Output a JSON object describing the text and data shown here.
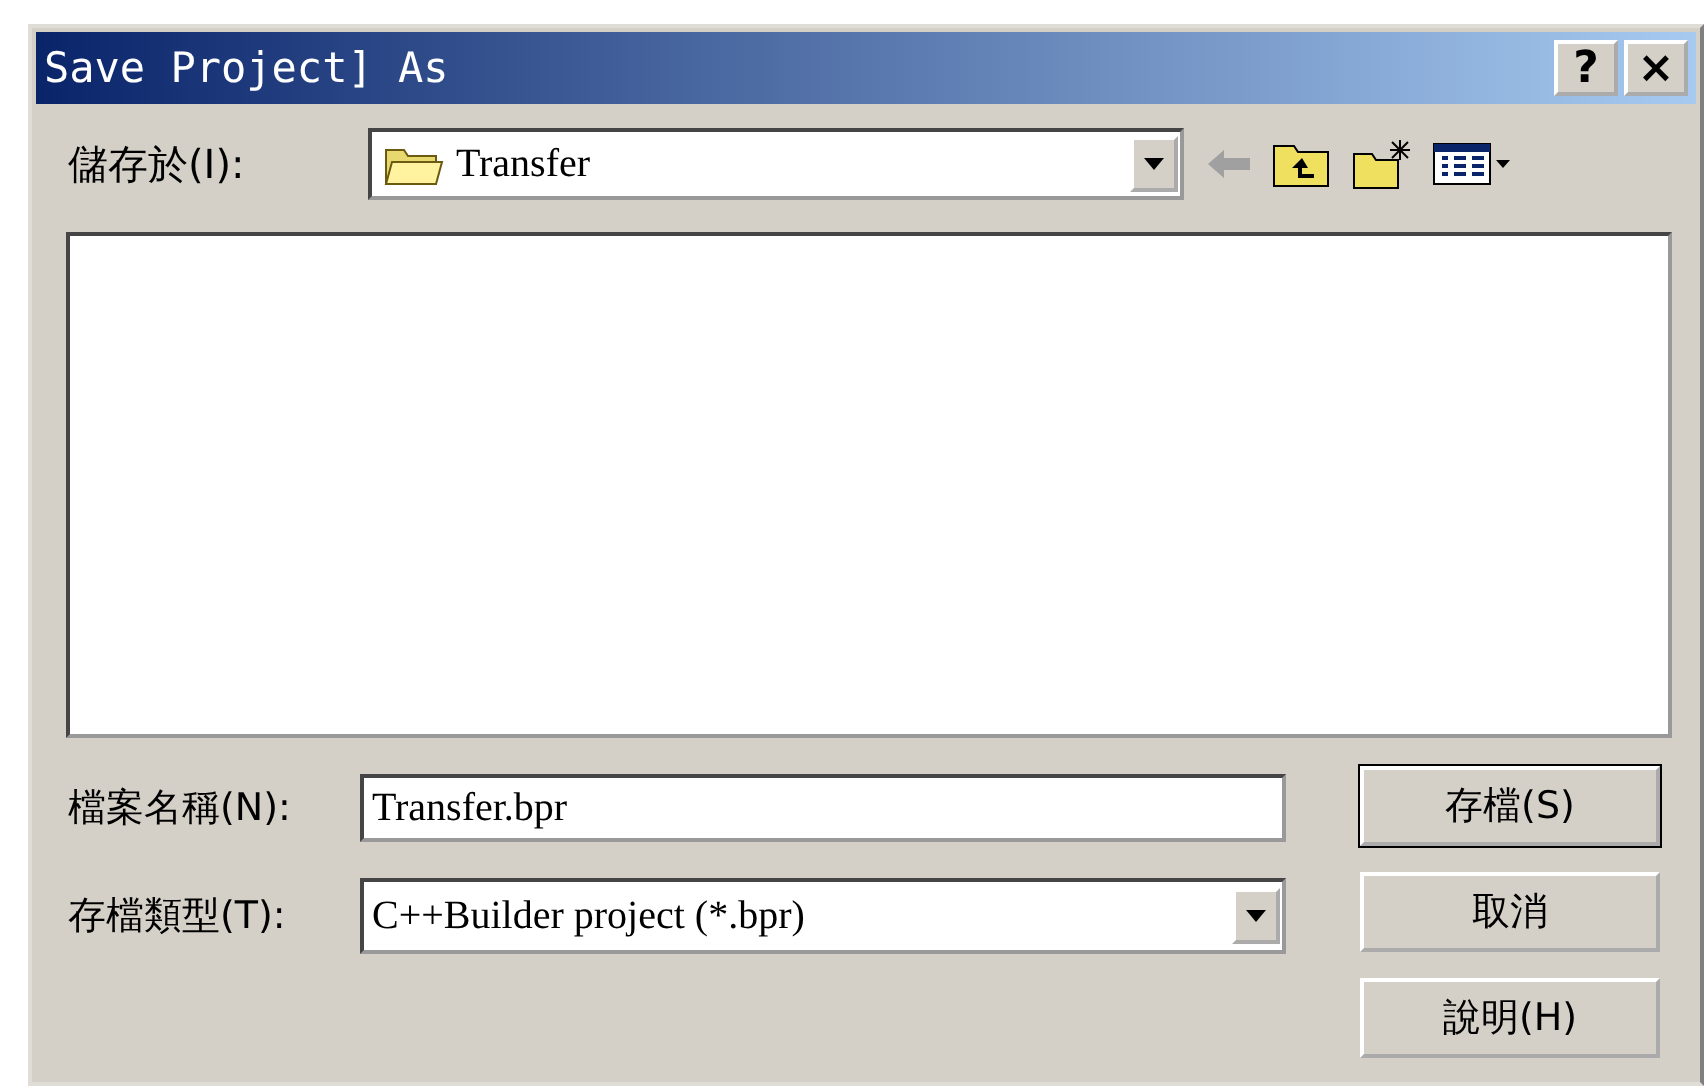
{
  "window": {
    "title": "Save Project] As"
  },
  "save_in": {
    "label": "儲存於(I):",
    "value": "Transfer"
  },
  "file_name": {
    "label": "檔案名稱(N):",
    "value": "Transfer.bpr"
  },
  "file_type": {
    "label": "存檔類型(T):",
    "value": "C++Builder project (*.bpr)"
  },
  "buttons": [
    {
      "label": "存檔(S)",
      "default": true
    },
    {
      "label": "取消",
      "default": false
    },
    {
      "label": "說明(H)",
      "default": false
    }
  ],
  "title_buttons": [
    "?",
    "×"
  ]
}
